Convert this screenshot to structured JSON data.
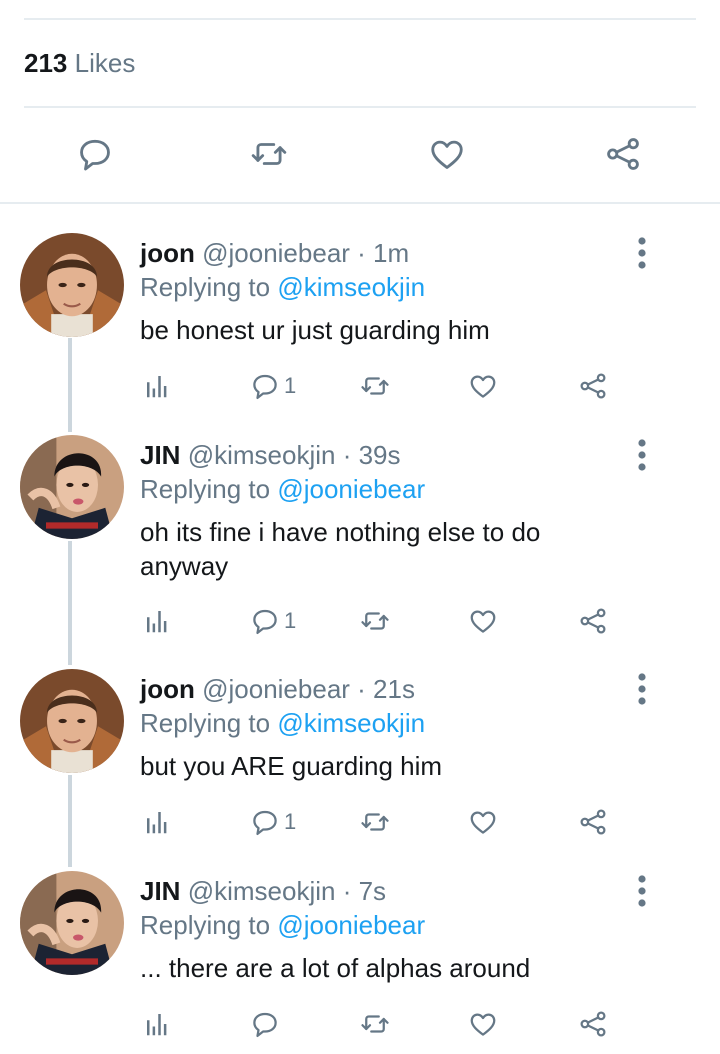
{
  "likes": {
    "count": "213",
    "label": "Likes"
  },
  "main_actions": [
    "reply-icon",
    "retweet-icon",
    "like-icon",
    "share-icon"
  ],
  "colors": {
    "link": "#1da1f2",
    "secondary": "#657786",
    "divider": "#e6ecf0",
    "thread": "#ccd6dd"
  },
  "tweets": [
    {
      "name": "joon",
      "handle": "@jooniebear",
      "time": "· 1m",
      "replying_label": "Replying to",
      "replying_to": "@kimseokjin",
      "text": "be honest ur just guarding him",
      "reply_count": "1"
    },
    {
      "name": "JIN",
      "handle": "@kimseokjin",
      "time": "· 39s",
      "replying_label": "Replying to",
      "replying_to": "@jooniebear",
      "text": "oh its fine i have nothing else to do anyway",
      "reply_count": "1"
    },
    {
      "name": "joon",
      "handle": "@jooniebear",
      "time": "· 21s",
      "replying_label": "Replying to",
      "replying_to": "@kimseokjin",
      "text": "but you ARE guarding him",
      "reply_count": "1"
    },
    {
      "name": "JIN",
      "handle": "@kimseokjin",
      "time": "· 7s",
      "replying_label": "Replying to",
      "replying_to": "@jooniebear",
      "text": "... there are a lot of alphas around",
      "reply_count": ""
    }
  ]
}
